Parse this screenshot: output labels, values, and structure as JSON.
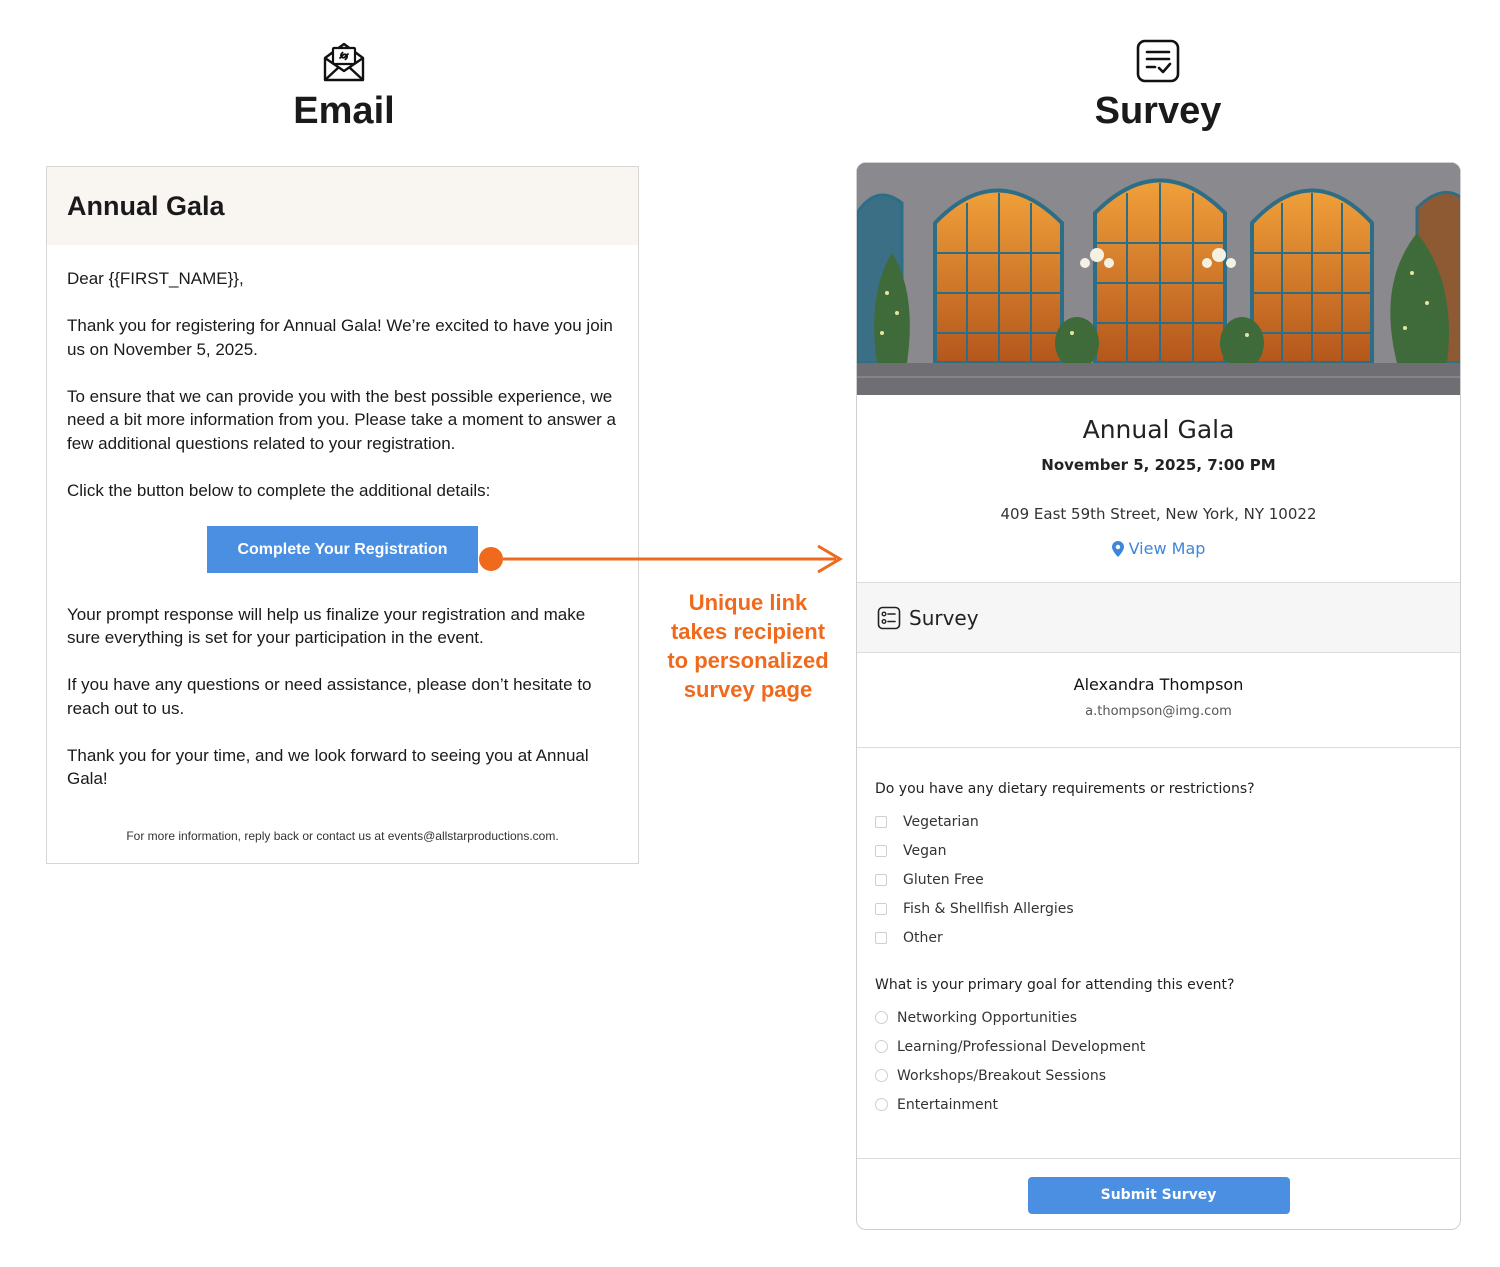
{
  "email_column": {
    "heading": "Email",
    "icon": "envelope-link-icon"
  },
  "survey_column": {
    "heading": "Survey",
    "icon": "survey-checklist-icon"
  },
  "email": {
    "subject_title": "Annual Gala",
    "greeting": "Dear {{FIRST_NAME}},",
    "paragraphs": [
      "Thank you for registering for Annual Gala! We’re excited to have you join us on November 5, 2025.",
      "To ensure that we can provide you with the best possible experience, we need a bit more information from you. Please take a moment to answer a few additional questions related to your registration.",
      "Click the button below to complete the additional details:"
    ],
    "button_label": "Complete Your Registration",
    "paragraphs_after": [
      "Your prompt response will help us finalize your registration and make sure everything is set for your participation in the event.",
      "If you have any questions or need assistance, please don’t hesitate to reach out to us.",
      "Thank you for your time, and we look forward to seeing you at Annual Gala!"
    ],
    "footer": "For more information, reply back or contact us at events@allstarproductions.com."
  },
  "annotation": {
    "lines": [
      "Unique link",
      "takes recipient",
      "to personalized",
      "survey page"
    ],
    "color": "#f06a1d"
  },
  "survey": {
    "event_title": "Annual Gala",
    "event_datetime": "November 5, 2025, 7:00 PM",
    "address": "409 East 59th Street, New York, NY 10022",
    "map_link": "View Map",
    "section_label": "Survey",
    "recipient_name": "Alexandra Thompson",
    "recipient_email": "a.thompson@img.com",
    "q1": {
      "label": "Do you have any dietary requirements or restrictions?",
      "options": [
        "Vegetarian",
        "Vegan",
        "Gluten Free",
        "Fish & Shellfish Allergies",
        "Other"
      ]
    },
    "q2": {
      "label": "What is your primary goal for attending this event?",
      "options": [
        "Networking Opportunities",
        "Learning/Professional Development",
        "Workshops/Breakout Sessions",
        "Entertainment"
      ]
    },
    "submit_label": "Submit Survey"
  },
  "colors": {
    "button_blue": "#4a8fe2",
    "link_blue": "#3d86dc",
    "accent_orange": "#f06a1d",
    "email_header_bg": "#f9f6f1"
  }
}
